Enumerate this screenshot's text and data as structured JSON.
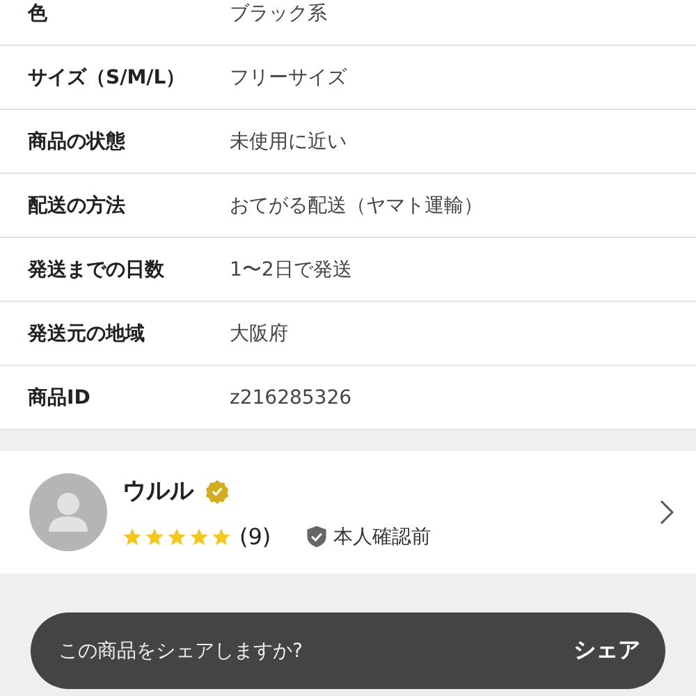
{
  "details": [
    {
      "label": "色",
      "value": "ブラック系"
    },
    {
      "label": "サイズ（S/M/L）",
      "value": "フリーサイズ"
    },
    {
      "label": "商品の状態",
      "value": "未使用に近い"
    },
    {
      "label": "配送の方法",
      "value": "おてがる配送（ヤマト運輸）"
    },
    {
      "label": "発送までの日数",
      "value": "1〜2日で発送"
    },
    {
      "label": "発送元の地域",
      "value": "大阪府"
    },
    {
      "label": "商品ID",
      "value": "z216285326"
    }
  ],
  "seller": {
    "name": "ウルル",
    "verified": true,
    "stars": 5,
    "review_count": "(9)",
    "identity_status": "本人確認前"
  },
  "snackbar": {
    "message": "この商品をシェアしますか?",
    "action": "シェア"
  }
}
